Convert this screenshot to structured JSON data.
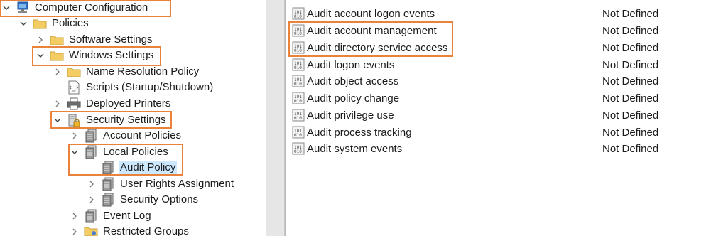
{
  "tree": {
    "computer_configuration": "Computer Configuration",
    "policies": "Policies",
    "software_settings": "Software Settings",
    "windows_settings": "Windows Settings",
    "name_resolution_policy": "Name Resolution Policy",
    "scripts": "Scripts (Startup/Shutdown)",
    "deployed_printers": "Deployed Printers",
    "security_settings": "Security Settings",
    "account_policies": "Account Policies",
    "local_policies": "Local Policies",
    "audit_policy": "Audit Policy",
    "user_rights_assignment": "User Rights Assignment",
    "security_options": "Security Options",
    "event_log": "Event Log",
    "restricted_groups": "Restricted Groups"
  },
  "policies": [
    {
      "name": "Audit account logon events",
      "setting": "Not Defined"
    },
    {
      "name": "Audit account management",
      "setting": "Not Defined"
    },
    {
      "name": "Audit directory service access",
      "setting": "Not Defined"
    },
    {
      "name": "Audit logon events",
      "setting": "Not Defined"
    },
    {
      "name": "Audit object access",
      "setting": "Not Defined"
    },
    {
      "name": "Audit policy change",
      "setting": "Not Defined"
    },
    {
      "name": "Audit privilege use",
      "setting": "Not Defined"
    },
    {
      "name": "Audit process tracking",
      "setting": "Not Defined"
    },
    {
      "name": "Audit system events",
      "setting": "Not Defined"
    }
  ],
  "colors": {
    "highlight_box": "#e8823d",
    "selection": "#cce8ff",
    "folder": "#f3cd63"
  },
  "icons": {
    "computer": "computer-icon",
    "folder": "folder-icon",
    "scripts": "script-document-icon",
    "printer": "printer-icon",
    "security": "security-lock-icon",
    "policy_book": "policy-book-icon",
    "policy_item": "policy-setting-icon"
  }
}
